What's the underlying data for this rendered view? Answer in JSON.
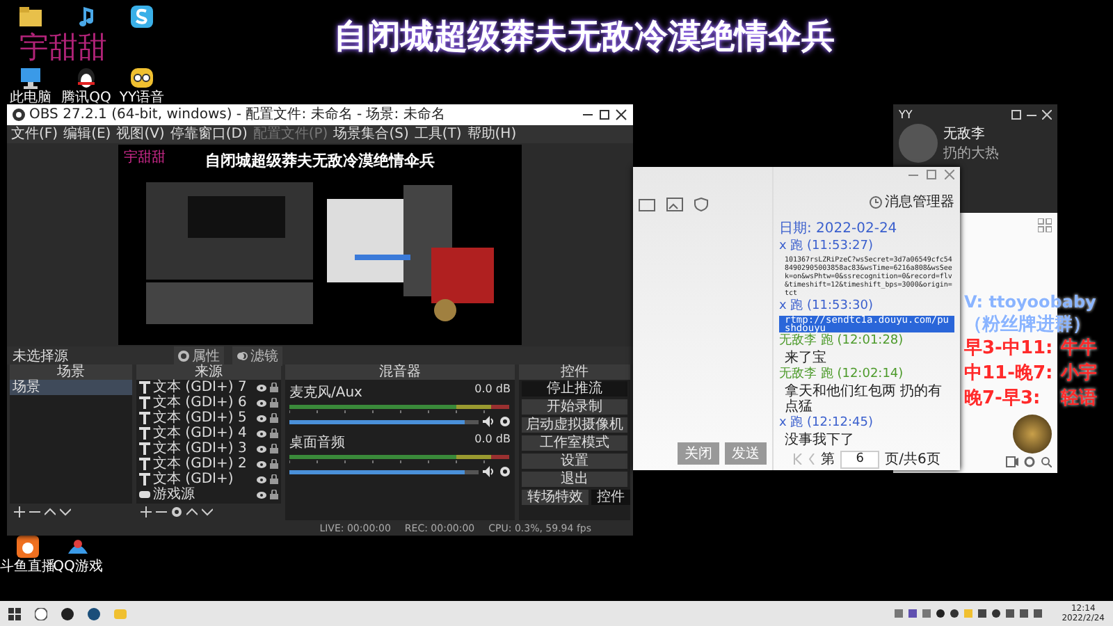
{
  "overlay": {
    "title": "自闭城超级莽夫无敌冷漠绝情伞兵",
    "streamer": "宇甜甜",
    "contact": "V: ttoyoobaby",
    "contact_note": "（粉丝牌进群）",
    "shifts": [
      {
        "time": "早3-中11:",
        "host": "牛牛"
      },
      {
        "time": "中11-晚7:",
        "host": "小宇"
      },
      {
        "time": "晚7-早3:",
        "host": "轻语"
      }
    ]
  },
  "desktop_icons": [
    {
      "kind": "folder"
    },
    {
      "kind": "music"
    },
    {
      "kind": "app"
    },
    {
      "kind": "pc",
      "label": "此电脑"
    },
    {
      "kind": "penguin",
      "label": "腾讯QQ"
    },
    {
      "kind": "yy",
      "label": "YY语音"
    }
  ],
  "desktop_icons_bottom": [
    {
      "kind": "orange",
      "label": "斗鱼直播"
    },
    {
      "kind": "game",
      "label": "QQ游戏"
    }
  ],
  "obs": {
    "title": "OBS 27.2.1 (64-bit, windows) - 配置文件: 未命名 - 场景: 未命名",
    "menu": [
      {
        "label": "文件(F)",
        "disabled": false
      },
      {
        "label": "编辑(E)",
        "disabled": false
      },
      {
        "label": "视图(V)",
        "disabled": false
      },
      {
        "label": "停靠窗口(D)",
        "disabled": false
      },
      {
        "label": "配置文件(P)",
        "disabled": true
      },
      {
        "label": "场景集合(S)",
        "disabled": false
      },
      {
        "label": "工具(T)",
        "disabled": false
      },
      {
        "label": "帮助(H)",
        "disabled": false
      }
    ],
    "preview": {
      "title": "自闭城超级莽夫无敌冷漠绝情伞兵",
      "streamer": "宇甜甜"
    },
    "source_bar": {
      "label": "未选择源",
      "buttons": [
        "属性",
        "滤镜"
      ]
    },
    "scenes": {
      "title": "场景",
      "items": [
        {
          "name": "场景",
          "selected": true
        }
      ]
    },
    "sources": {
      "title": "来源",
      "items": [
        {
          "name": "文本 (GDI+) 7",
          "kind": "text"
        },
        {
          "name": "文本 (GDI+) 6",
          "kind": "text"
        },
        {
          "name": "文本 (GDI+) 5",
          "kind": "text"
        },
        {
          "name": "文本 (GDI+) 4",
          "kind": "text"
        },
        {
          "name": "文本 (GDI+) 3",
          "kind": "text"
        },
        {
          "name": "文本 (GDI+) 2",
          "kind": "text"
        },
        {
          "name": "文本 (GDI+)",
          "kind": "text"
        },
        {
          "name": "游戏源",
          "kind": "game"
        }
      ]
    },
    "mixer": {
      "title": "混音器",
      "channels": [
        {
          "name": "麦克风/Aux",
          "reading": "0.0 dB",
          "level": 0.93
        },
        {
          "name": "桌面音频",
          "reading": "0.0 dB",
          "level": 0.93
        }
      ]
    },
    "controls": {
      "title": "控件",
      "buttons": [
        {
          "label": "停止推流",
          "active": true
        },
        {
          "label": "开始录制",
          "active": false
        },
        {
          "label": "启动虚拟摄像机",
          "active": false
        },
        {
          "label": "工作室模式",
          "active": false
        },
        {
          "label": "设置",
          "active": false
        },
        {
          "label": "退出",
          "active": false
        }
      ],
      "tabs": [
        {
          "label": "转场特效",
          "selected": false
        },
        {
          "label": "控件",
          "selected": true
        }
      ]
    },
    "status": {
      "live": "LIVE: 00:00:00",
      "rec": "REC: 00:00:00",
      "cpu": "CPU: 0.3%, 59.94 fps"
    }
  },
  "chat": {
    "manager": "消息管理器",
    "date": "日期: 2022-02-24",
    "messages": [
      {
        "meta": "x 跑 (11:53:27)",
        "text": "101367rsLZRiPzeC?wsSecret=3d7a06549cfc5484902905003858ac83&wsTime=6216a808&wsSeek=on&wsPhtw=0&ssrecognition=0&record=flv&timeshift=12&timeshift_bps=3000&origin=tct",
        "color": "#3a5fcd",
        "highlighted": false
      },
      {
        "meta": "x 跑 (11:53:30)",
        "text": "rtmp://sendtc1a.douyu.com/pushdouyu",
        "color": "#3a5fcd",
        "highlighted": true
      },
      {
        "meta": "无敌李 跑 (12:01:28)",
        "text": "来了宝",
        "color": "#4c9a2a",
        "highlighted": false
      },
      {
        "meta": "无敌李 跑 (12:02:14)",
        "text": "拿天和他们红包两 扔的有点猛",
        "color": "#4c9a2a",
        "highlighted": false
      },
      {
        "meta": "x 跑 (12:12:45)",
        "text": "没事我下了",
        "color": "#3a5fcd",
        "highlighted": false
      }
    ],
    "buttons": [
      "关闭",
      "发送"
    ],
    "pager": {
      "prefix": "第",
      "page": "6",
      "suffix": "页/共6页"
    }
  },
  "yy": {
    "title": "YY",
    "name": "无敌李",
    "status": "扔的大热"
  },
  "taskbar": {
    "time": "12:14",
    "date": "2022/2/24"
  }
}
